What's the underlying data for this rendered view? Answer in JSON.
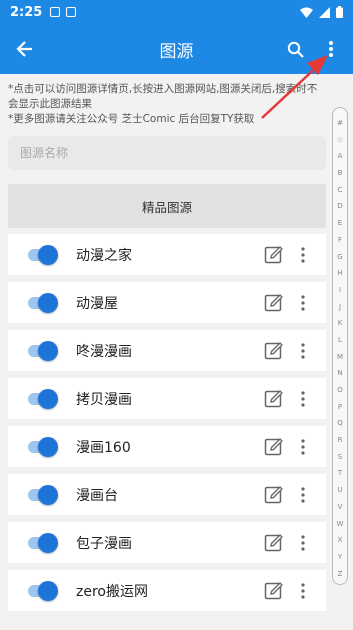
{
  "status_bar": {
    "time": "2:25"
  },
  "app_bar": {
    "title": "图源"
  },
  "hints": {
    "line1": "*点击可以访问图源详情页,长按进入图源网站,图源关闭后,搜索时不会显示此图源结果",
    "line2": "*更多图源请关注公众号 芝士Comic 后台回复TY获取"
  },
  "search": {
    "placeholder": "图源名称",
    "value": ""
  },
  "section": {
    "title": "精品图源"
  },
  "sources": [
    {
      "name": "动漫之家",
      "enabled": true
    },
    {
      "name": "动漫屋",
      "enabled": true
    },
    {
      "name": "咚漫漫画",
      "enabled": true
    },
    {
      "name": "拷贝漫画",
      "enabled": true
    },
    {
      "name": "漫画160",
      "enabled": true
    },
    {
      "name": "漫画台",
      "enabled": true
    },
    {
      "name": "包子漫画",
      "enabled": true
    },
    {
      "name": "zero搬运网",
      "enabled": true
    }
  ],
  "index_letters": [
    "#",
    "☆",
    "A",
    "B",
    "C",
    "D",
    "E",
    "F",
    "G",
    "H",
    "I",
    "J",
    "K",
    "L",
    "M",
    "N",
    "O",
    "P",
    "Q",
    "R",
    "S",
    "T",
    "U",
    "V",
    "W",
    "X",
    "Y",
    "Z"
  ],
  "colors": {
    "primary": "#1e88e5",
    "toggle_on": "#1e74d6",
    "annotation_arrow": "#e53935"
  }
}
